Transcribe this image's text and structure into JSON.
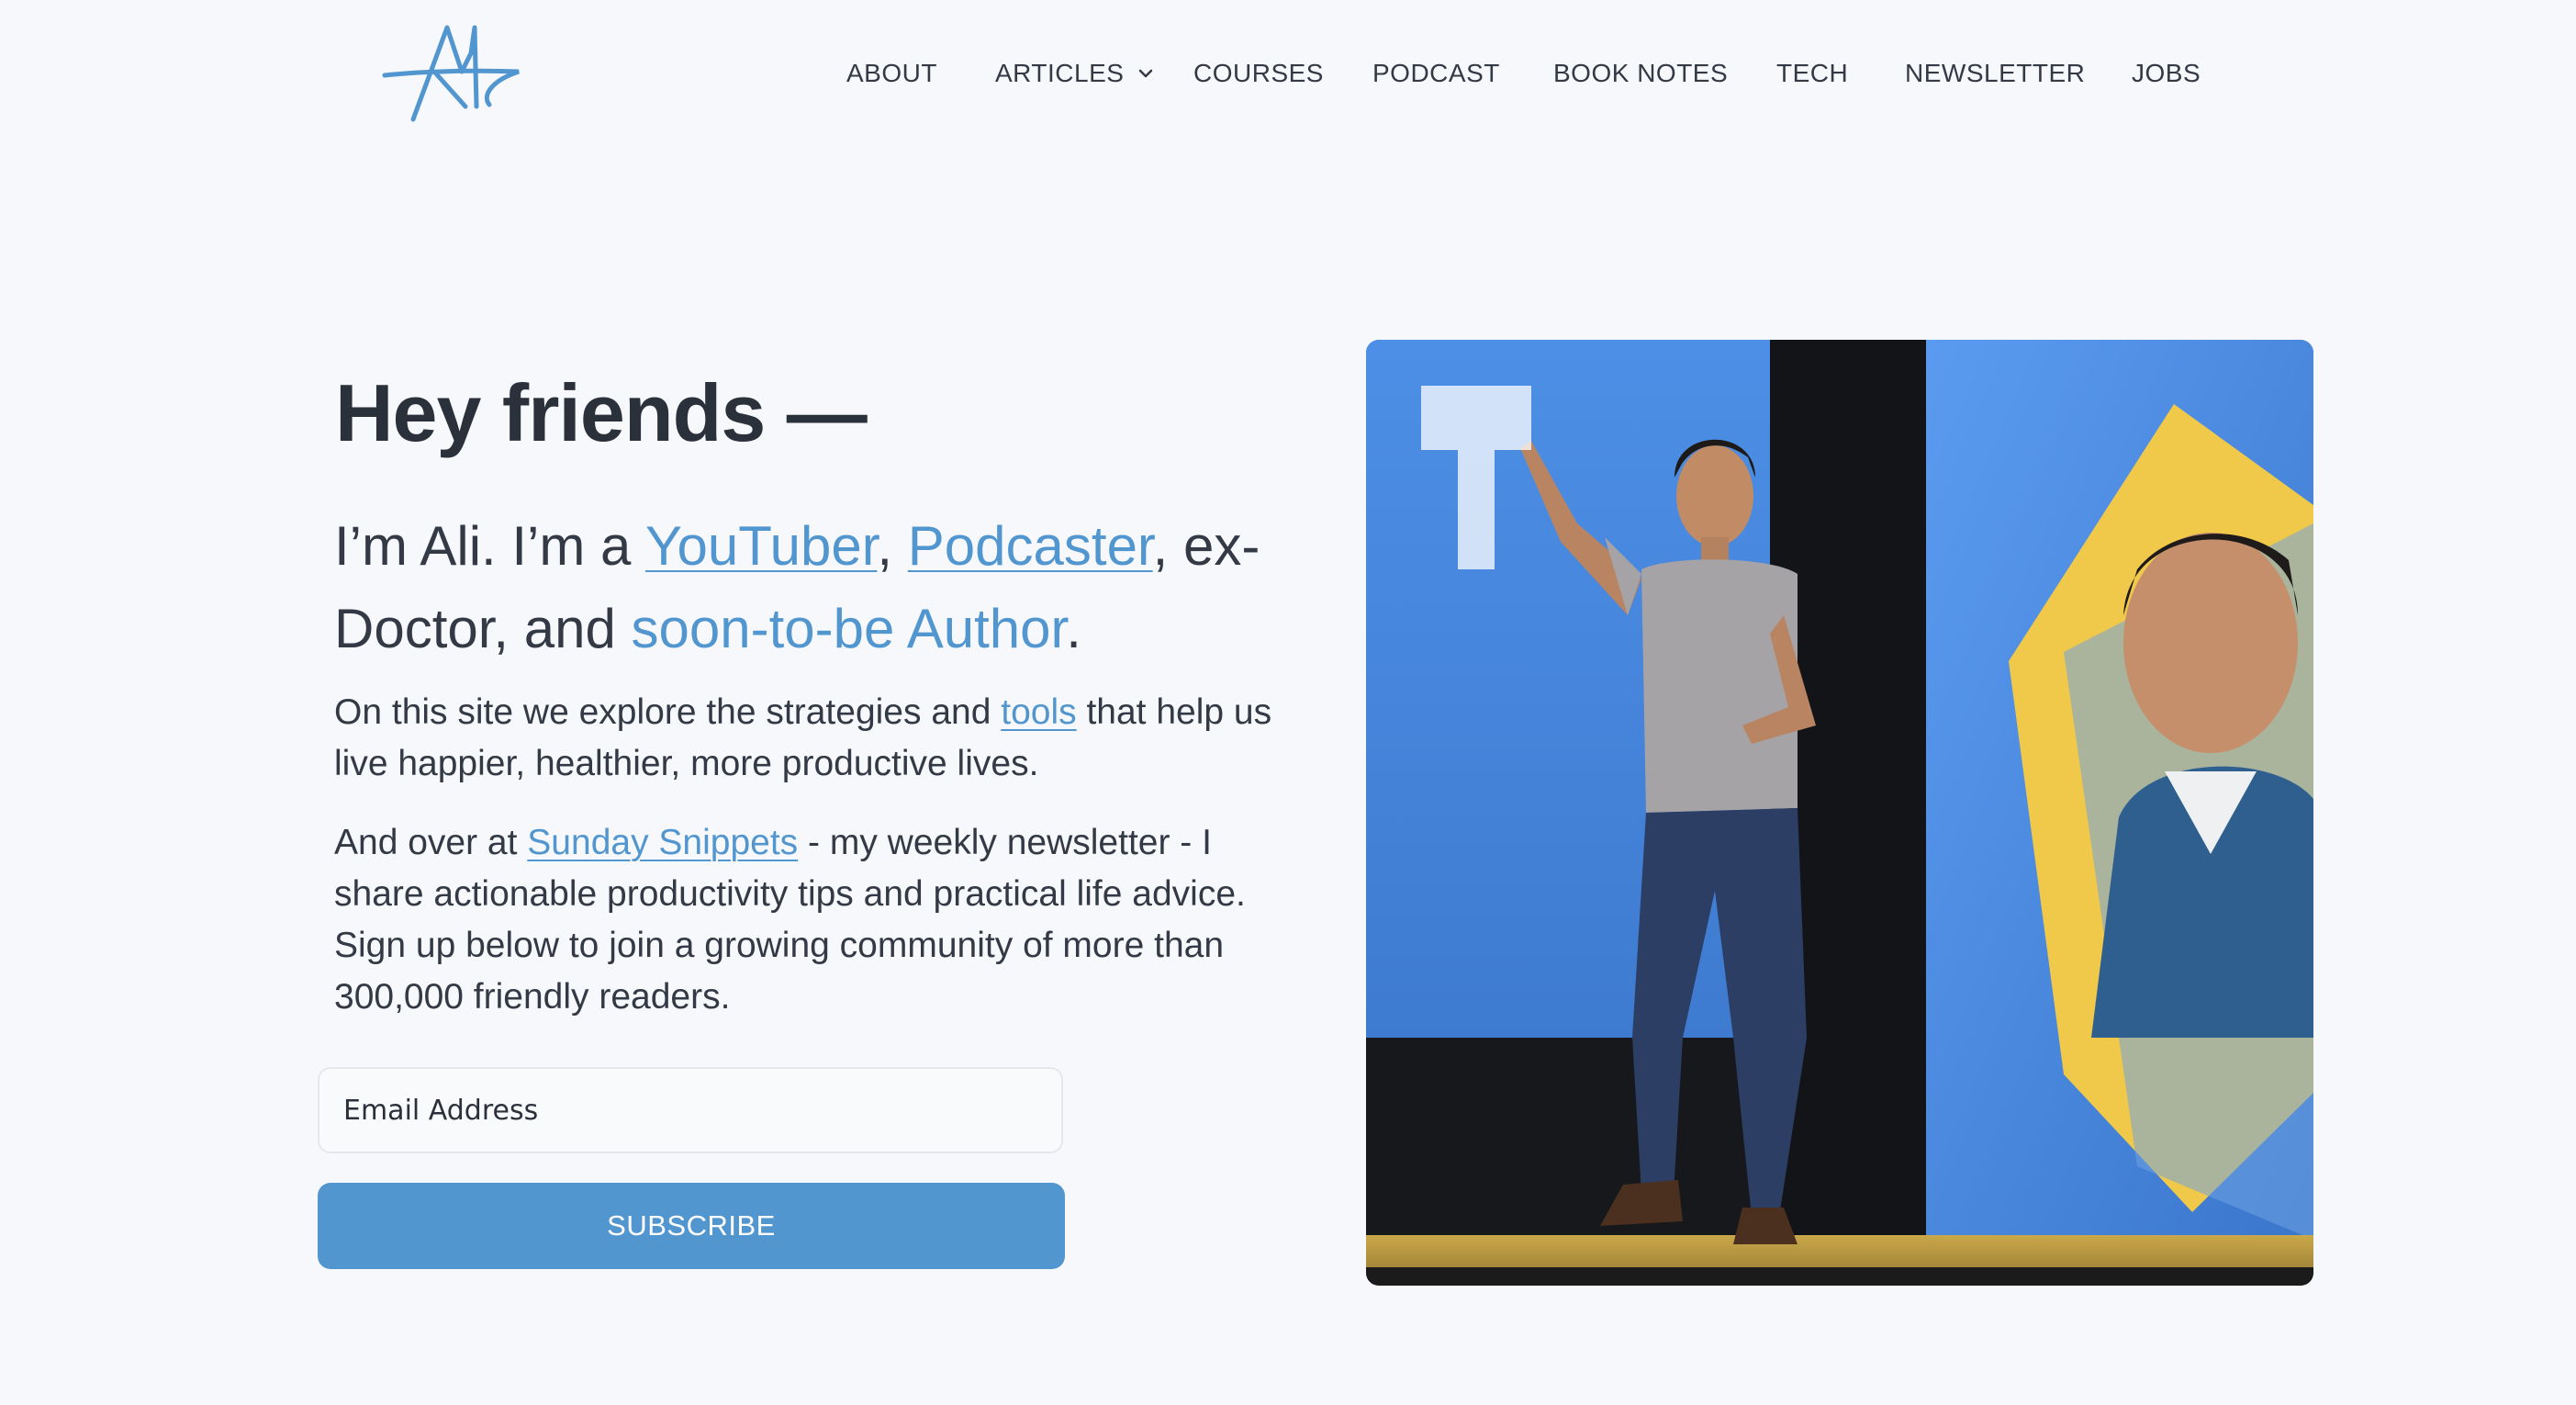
{
  "header": {
    "logo_alt": "Ali logo",
    "nav": {
      "about": "ABOUT",
      "articles": "ARTICLES",
      "courses": "COURSES",
      "podcast": "PODCAST",
      "book_notes": "BOOK NOTES",
      "tech": "TECH",
      "newsletter": "NEWSLETTER",
      "jobs": "JOBS"
    }
  },
  "hero": {
    "title": "Hey friends —",
    "intro": {
      "part1": "I’m Ali. I’m a ",
      "youtuber": "YouTuber",
      "comma1": ", ",
      "podcaster": "Podcaster",
      "part2": ", ex-Doctor, and ",
      "author": "soon-to-be Author",
      "period": "."
    },
    "p1": {
      "before": "On this site we explore the strategies and ",
      "link": "tools",
      "after": " that help us live happier, healthier, more productive lives."
    },
    "p2": {
      "before": "And over at ",
      "link": "Sunday Snippets",
      "after": " - my weekly newsletter - I share actionable productivity tips and practical life advice. Sign up below to join a growing community of more than 300,000 friendly readers."
    },
    "email_placeholder": "Email Address",
    "subscribe_label": "SUBSCRIBE",
    "photo_alt": "Ali speaking on stage"
  },
  "colors": {
    "accent": "#5296d0",
    "text": "#333a45",
    "background": "#f7f8fb"
  }
}
